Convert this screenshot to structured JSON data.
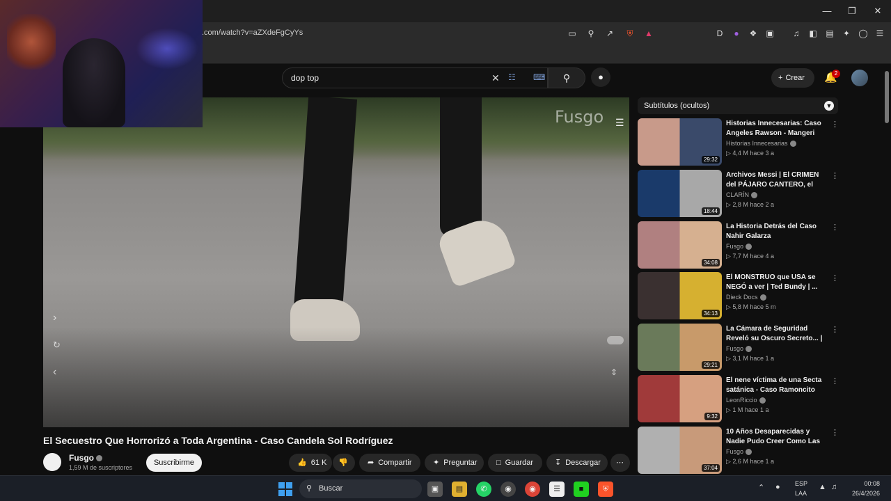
{
  "browser": {
    "url": ".com/watch?v=aZXdeFgCyYs"
  },
  "header": {
    "search_value": "dop top",
    "create_label": "Crear",
    "notification_count": "2"
  },
  "video": {
    "watermark": "Fusgo",
    "title": "El Secuestro Que Horrorizó a Toda Argentina - Caso Candela Sol Rodríguez",
    "channel": "Fusgo",
    "subscribers": "1,59 M de suscriptores",
    "subscribe_label": "Suscribirme",
    "likes": "61 K",
    "share_label": "Compartir",
    "ask_label": "Preguntar",
    "save_label": "Guardar",
    "download_label": "Descargar"
  },
  "sidebar": {
    "chip_label": "Subtítulos (ocultos)",
    "recommendations": [
      {
        "title": "Historias Innecesarias: Caso Angeles Rawson - Mangeri",
        "channel": "Historias Innecesarias",
        "meta": "4,4 M  hace 3 a",
        "duration": "29:32",
        "color1": "#c89a8a",
        "color2": "#3a4a6a"
      },
      {
        "title": "Archivos Messi | El CRIMEN del PÁJARO CANTERO, el LÍDER ...",
        "channel": "CLARÍN",
        "meta": "2,8 M  hace 2 a",
        "duration": "18:44",
        "color1": "#1a3a6a",
        "color2": "#a8a8a8"
      },
      {
        "title": "La Historia Detrás del Caso Nahir Galarza",
        "channel": "Fusgo",
        "meta": "7,7 M  hace 4 a",
        "duration": "34:08",
        "color1": "#b08080",
        "color2": "#d6b090"
      },
      {
        "title": "El MONSTRUO que USA se NEGÓ a ver | Ted Bundy | ...",
        "channel": "Dieck Docs",
        "meta": "5,8 M  hace 5 m",
        "duration": "34:13",
        "color1": "#3a3030",
        "color2": "#d6b030"
      },
      {
        "title": "La Cámara de Seguridad Reveló su Oscuro Secreto... | Caso ...",
        "channel": "Fusgo",
        "meta": "3,1 M  hace 1 a",
        "duration": "29:21",
        "color1": "#6a7a5a",
        "color2": "#c89a6a"
      },
      {
        "title": "El nene víctima de una Secta satánica - Caso Ramoncito",
        "channel": "LeonRiccio",
        "meta": "1 M  hace 1 a",
        "duration": "9:32",
        "color1": "#a03a3a",
        "color2": "#d6a080"
      },
      {
        "title": "10 Años Desaparecidas y Nadie Pudo Creer Como Las ...",
        "channel": "Fusgo",
        "meta": "2,6 M  hace 1 a",
        "duration": "37:04",
        "color1": "#b0b0b0",
        "color2": "#c89a7a"
      }
    ]
  },
  "taskbar": {
    "search_label": "Buscar",
    "lang1": "ESP",
    "lang2": "LAA",
    "time": "00:08",
    "date": "26/4/2026"
  }
}
